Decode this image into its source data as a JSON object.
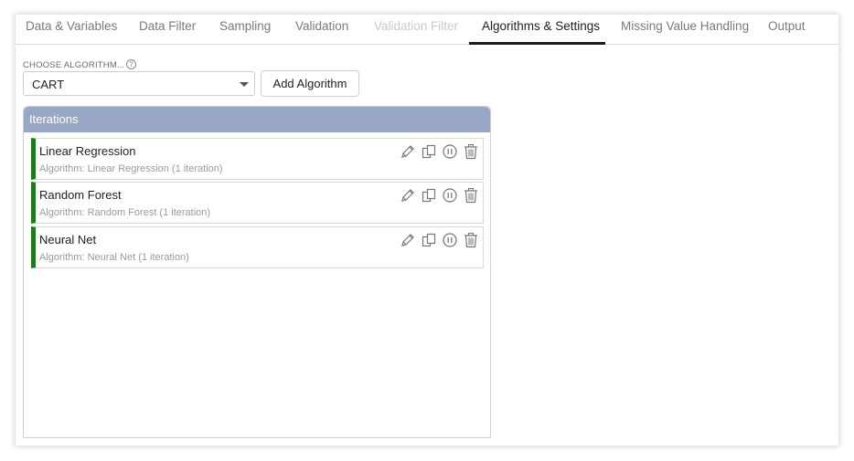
{
  "tabs": [
    {
      "label": "Data & Variables",
      "state": "normal"
    },
    {
      "label": "Data Filter",
      "state": "normal"
    },
    {
      "label": "Sampling",
      "state": "normal"
    },
    {
      "label": "Validation",
      "state": "normal"
    },
    {
      "label": "Validation Filter",
      "state": "disabled"
    },
    {
      "label": "Algorithms & Settings",
      "state": "active"
    },
    {
      "label": "Missing Value Handling",
      "state": "normal"
    },
    {
      "label": "Output",
      "state": "normal"
    }
  ],
  "algorithm_picker": {
    "label": "CHOOSE ALGORITHM...",
    "help_icon": "?",
    "selected": "CART",
    "add_button": "Add Algorithm"
  },
  "iterations": {
    "header": "Iterations",
    "accent_color": "#12820f",
    "header_color": "#98a7c5",
    "items": [
      {
        "title": "Linear Regression",
        "subtitle": "Algorithm: Linear Regression (1 iteration)"
      },
      {
        "title": "Random Forest",
        "subtitle": "Algorithm: Random Forest (1 iteration)"
      },
      {
        "title": "Neural Net",
        "subtitle": "Algorithm: Neural Net (1 iteration)"
      }
    ],
    "row_actions": [
      "edit-icon",
      "copy-icon",
      "pause-icon",
      "trash-icon"
    ]
  }
}
